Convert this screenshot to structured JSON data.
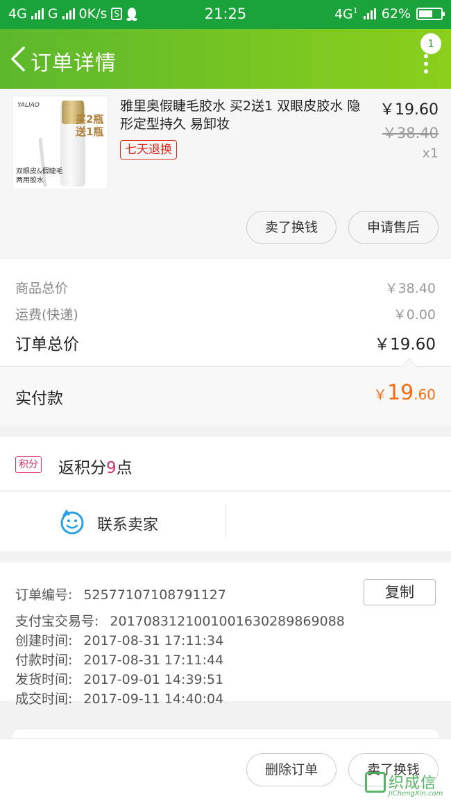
{
  "status_bar": {
    "network1": "4G",
    "network2": "G",
    "speed": "0K/s",
    "s_badge": "S",
    "time": "21:25",
    "network_right": "4G",
    "network_right_sub": "1",
    "battery": "62%",
    "battery_level": 0.62
  },
  "header": {
    "title": "订单详情",
    "notification_count": "1",
    "back_icon": "chevron-left-icon",
    "more_icon": "vertical-dots-icon"
  },
  "product": {
    "title": "雅里奥假睫毛胶水 买2送1 双眼皮胶水 隐形定型持久 易卸妆",
    "tag": "七天退换",
    "price": "￥19.60",
    "original_price": "￥38.40",
    "quantity": "x1",
    "image": {
      "logo": "YALIAO",
      "promo": "买2瓶\n送1瓶",
      "caption": "双眼皮&假睫毛\n两用胶水"
    },
    "buttons": {
      "sell": "卖了换钱",
      "after_sale": "申请售后"
    }
  },
  "summary": {
    "goods_total_label": "商品总价",
    "goods_total_value": "￥38.40",
    "shipping_label": "运费(快递)",
    "shipping_value": "￥0.00",
    "order_total_label": "订单总价",
    "order_total_value": "￥19.60"
  },
  "paid": {
    "label": "实付款",
    "currency": "￥",
    "integer": "19",
    "decimal": ".60"
  },
  "points": {
    "tag": "积分",
    "prefix": "返积分",
    "number": "9",
    "suffix": "点"
  },
  "contact": {
    "label": "联系卖家",
    "icon": "chat-smile-icon"
  },
  "order_info": {
    "copy_label": "复制",
    "rows": [
      {
        "key": "订单编号:",
        "value": "52577107108791127"
      },
      {
        "key": "支付宝交易号:",
        "value": "2017083121001001630289869088"
      },
      {
        "key": "创建时间:",
        "value": "2017-08-31 17:11:34"
      },
      {
        "key": "付款时间:",
        "value": "2017-08-31 17:11:44"
      },
      {
        "key": "发货时间:",
        "value": "2017-09-01 14:39:51"
      },
      {
        "key": "成交时间:",
        "value": "2017-09-11 14:40:04"
      }
    ]
  },
  "bottom_bar": {
    "delete_label": "删除订单",
    "sell_label": "卖了换钱"
  },
  "watermark": {
    "text": "织成信",
    "url": "JiChengXin.com"
  },
  "colors": {
    "status_bar": "#1aa33a",
    "header_start": "#5cb82c",
    "header_end": "#8ccf1c",
    "paid_accent": "#f56d10",
    "tag_red": "#e0261c",
    "points_pink": "#d6336c"
  }
}
